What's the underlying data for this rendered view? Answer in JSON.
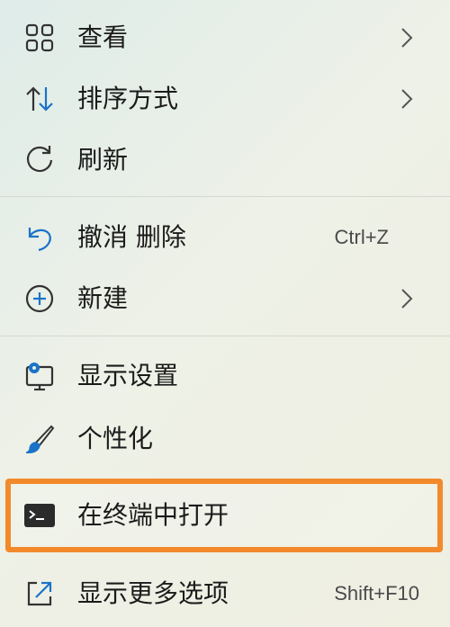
{
  "menu": {
    "items": [
      {
        "label": "查看",
        "icon": "grid-view-icon",
        "submenu": true
      },
      {
        "label": "排序方式",
        "icon": "sort-arrows-icon",
        "submenu": true
      },
      {
        "label": "刷新",
        "icon": "refresh-icon",
        "submenu": false
      },
      {
        "label": "撤消 删除",
        "icon": "undo-icon",
        "shortcut": "Ctrl+Z"
      },
      {
        "label": "新建",
        "icon": "add-circle-icon",
        "submenu": true
      },
      {
        "label": "显示设置",
        "icon": "display-settings-icon",
        "submenu": false
      },
      {
        "label": "个性化",
        "icon": "paintbrush-icon",
        "submenu": false
      },
      {
        "label": "在终端中打开",
        "icon": "terminal-icon",
        "submenu": false,
        "highlighted": true
      },
      {
        "label": "显示更多选项",
        "icon": "show-more-options-icon",
        "shortcut": "Shift+F10"
      }
    ]
  },
  "colors": {
    "accent_blue": "#1a73c8",
    "highlight_orange": "#f28a2c",
    "separator": "#d4d8d0"
  }
}
